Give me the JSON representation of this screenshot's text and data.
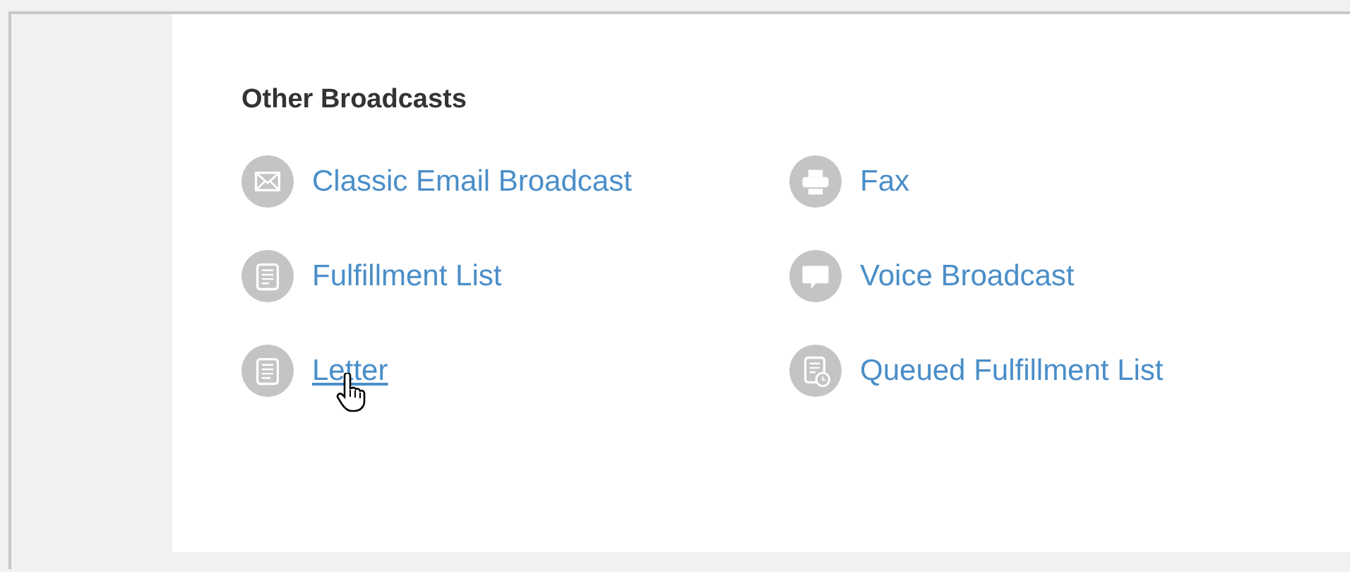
{
  "section": {
    "title": "Other Broadcasts",
    "items": [
      {
        "label": "Classic Email Broadcast",
        "hovered": false
      },
      {
        "label": "Fax",
        "hovered": false
      },
      {
        "label": "Fulfillment List",
        "hovered": false
      },
      {
        "label": "Voice Broadcast",
        "hovered": false
      },
      {
        "label": "Letter",
        "hovered": true
      },
      {
        "label": "Queued Fulfillment List",
        "hovered": false
      }
    ]
  }
}
